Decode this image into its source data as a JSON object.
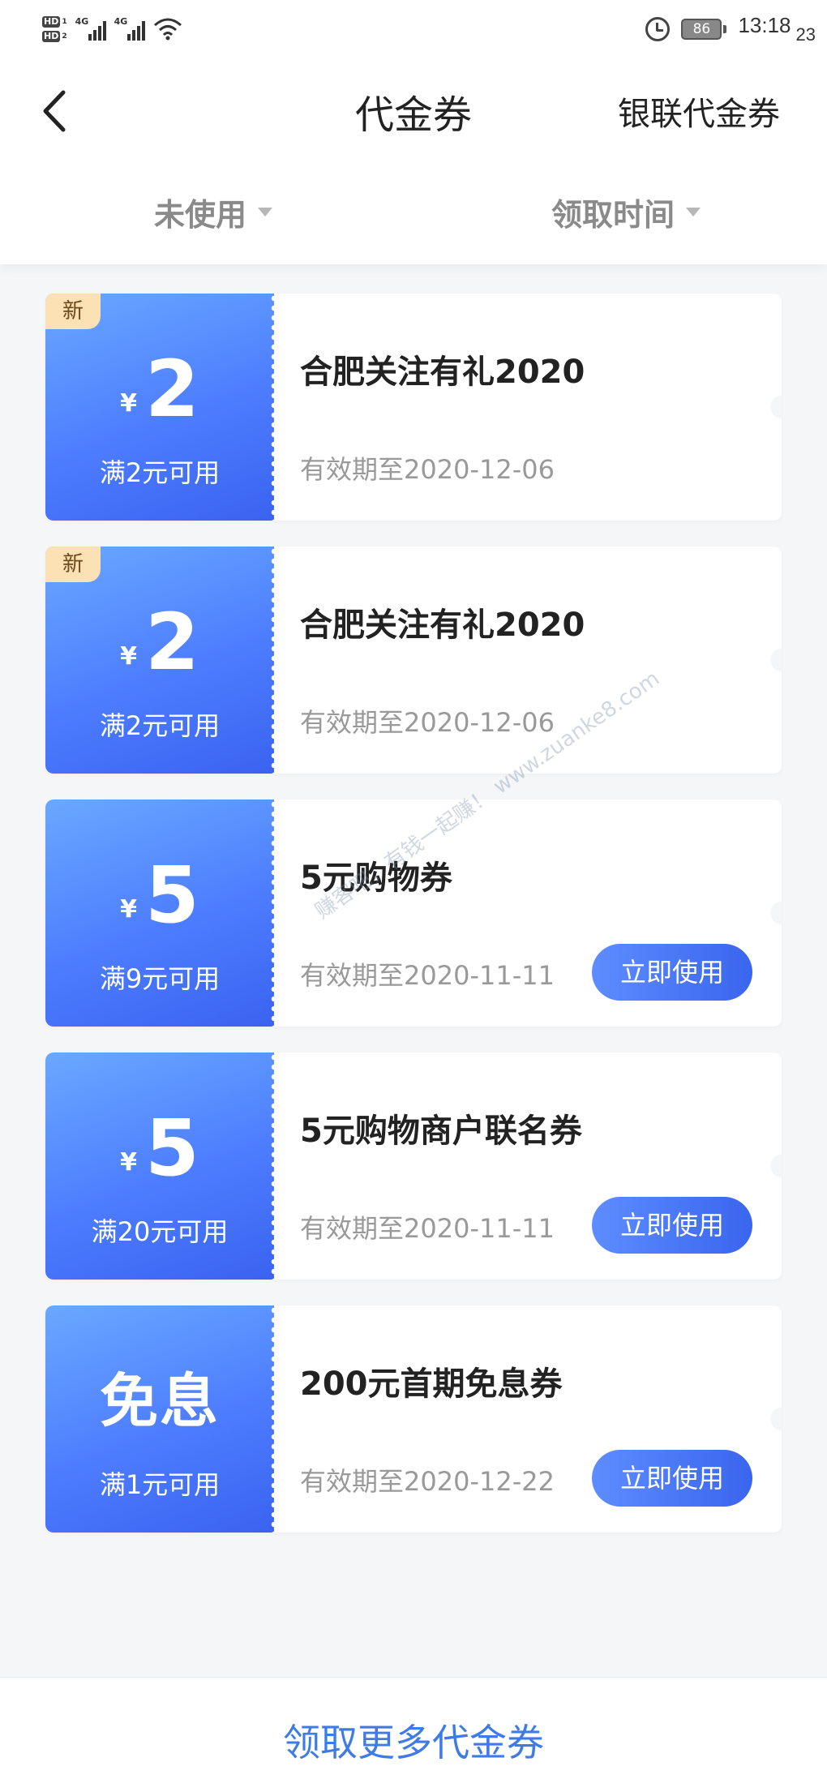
{
  "status_bar": {
    "hd1": "HD",
    "hd1_sub": "1",
    "hd2": "HD",
    "hd2_sub": "2",
    "net1": "4G",
    "net2": "4G",
    "battery": "86",
    "time": "13:18",
    "seconds": "23"
  },
  "header": {
    "title": "代金券",
    "right_link": "银联代金券"
  },
  "filters": {
    "status": "未使用",
    "sort": "领取时间"
  },
  "coupons": [
    {
      "badge": "新",
      "currency": "¥",
      "amount": "2",
      "condition": "满2元可用",
      "title": "合肥关注有礼2020",
      "valid": "有效期至2020-12-06",
      "button": ""
    },
    {
      "badge": "新",
      "currency": "¥",
      "amount": "2",
      "condition": "满2元可用",
      "title": "合肥关注有礼2020",
      "valid": "有效期至2020-12-06",
      "button": ""
    },
    {
      "badge": "",
      "currency": "¥",
      "amount": "5",
      "condition": "满9元可用",
      "title": "5元购物券",
      "valid": "有效期至2020-11-11",
      "button": "立即使用"
    },
    {
      "badge": "",
      "currency": "¥",
      "amount": "5",
      "condition": "满20元可用",
      "title": "5元购物商户联名券",
      "valid": "有效期至2020-11-11",
      "button": "立即使用"
    },
    {
      "badge": "",
      "currency": "",
      "amount": "免息",
      "condition": "满1元可用",
      "title": "200元首期免息券",
      "valid": "有效期至2020-12-22",
      "button": "立即使用"
    }
  ],
  "watermark": "赚客吧，有钱一起赚！ www.zuanke8.com",
  "footer": {
    "link": "领取更多代金券"
  },
  "colors": {
    "accent": "#3f7be6",
    "coupon_gradient_start": "#6aa8ff",
    "coupon_gradient_end": "#3a63f0",
    "badge_bg": "#fbe1b4"
  }
}
